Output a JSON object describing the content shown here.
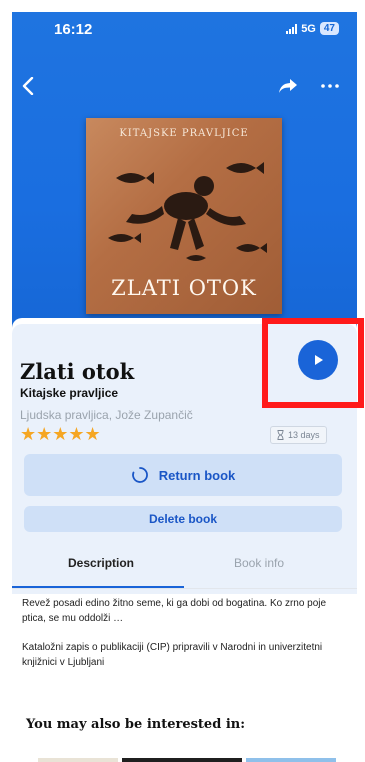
{
  "status_bar": {
    "time": "16:12",
    "network": "5G",
    "battery": "47"
  },
  "cover": {
    "subtitle": "KITAJSKE PRAVLJICE",
    "title": "ZLATI OTOK"
  },
  "book": {
    "title": "Zlati otok",
    "subtitle": "Kitajske pravljice",
    "authors": "Ljudska pravljica, Jože Zupančič",
    "rating": 5,
    "stars": "★★★★★",
    "loan_period": "13 days"
  },
  "actions": {
    "return_label": "Return book",
    "delete_label": "Delete book"
  },
  "tabs": [
    {
      "label": "Description",
      "active": true
    },
    {
      "label": "Book info",
      "active": false
    }
  ],
  "description": {
    "paragraph1": "Revež posadi edino žitno seme, ki ga dobi od bogatina. Ko zrno poje ptica, se mu oddolži …",
    "paragraph2": "Kataložni zapis o publikaciji (CIP) pripravili v Narodni in univerzitetni knjižnici v Ljubljani"
  },
  "recommendations": {
    "heading": "You may also be interested in:"
  },
  "icons": {
    "back": "chevron-left-icon",
    "share": "share-arrow-icon",
    "more": "more-horizontal-icon",
    "play": "play-icon",
    "hourglass": "hourglass-icon",
    "return": "return-spinner-icon"
  },
  "colors": {
    "hero_blue": "#1a6ee0",
    "accent_blue": "#1a64d8",
    "button_bg": "#cfe0f7",
    "star": "#f5a623",
    "highlight": "#ff1a1a"
  }
}
